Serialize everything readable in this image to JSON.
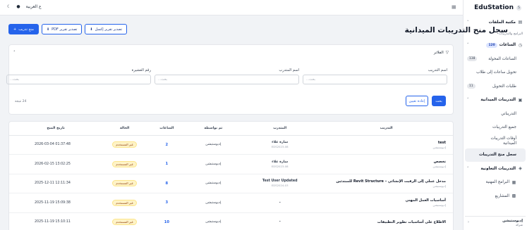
{
  "brand": {
    "title": "EduStation",
    "badge": "S"
  },
  "topbar": {
    "language": "العربية",
    "language_prefix": "ع"
  },
  "sidebar": {
    "items": [
      {
        "label": "مكتبة الملفات",
        "kind": "section",
        "icon": "folder-icon",
        "chevron": "˅"
      },
      {
        "label": "البرامج والتدريبات",
        "kind": "small"
      },
      {
        "label": "الساعات",
        "kind": "section",
        "icon": "clock-icon",
        "badge": "120",
        "chevron": "˄"
      },
      {
        "label": "الساعات المحولة",
        "kind": "sub",
        "badge": "138",
        "badge_left": true
      },
      {
        "label": "تحويل ساعات إلى طلاب",
        "kind": "sub"
      },
      {
        "label": "طلبات التحويل",
        "kind": "sub",
        "badge": "11",
        "badge_left": true
      },
      {
        "label": "التدريبات الميدانية",
        "kind": "section",
        "icon": "briefcase-icon",
        "chevron": "˄"
      },
      {
        "label": "التدريباتي",
        "kind": "sub"
      },
      {
        "label": "جميع التدريبات",
        "kind": "sub"
      },
      {
        "label": "أوقات التدريبات الميدانية",
        "kind": "sub",
        "wrap": true
      },
      {
        "label": "سجل منح التدريبات",
        "kind": "sub",
        "active": true
      },
      {
        "label": "التدريبات التعاونية",
        "kind": "section",
        "icon": "handshake-icon",
        "chevron": "˄"
      },
      {
        "label": "البرامج المهنية",
        "kind": "sub",
        "icon": "book-icon"
      },
      {
        "label": "المشاريع",
        "kind": "sub",
        "icon": "grid-icon"
      }
    ],
    "user": {
      "name": "إديوستيشن",
      "org": "شركة"
    }
  },
  "main": {
    "title": "سجل منح التدريبات الميدانية",
    "actions": [
      {
        "label": "منح تدريب",
        "icon": "+",
        "primary": true
      },
      {
        "label": "تصدير تقرير PDF",
        "icon": "⬇",
        "primary": false
      },
      {
        "label": "تصدير تقرير إكسل",
        "icon": "⬇",
        "primary": false
      }
    ]
  },
  "filters": {
    "title": "الفلاتر",
    "fields": [
      {
        "label": "اسم التدريب",
        "placeholder": "بحث..."
      },
      {
        "label": "اسم المتدرب",
        "placeholder": "بحث..."
      },
      {
        "label": "رقم العشيرة",
        "placeholder": "بحث..."
      }
    ],
    "search_label": "بحث",
    "reset_label": "إعادة تعيين",
    "count_label": "24 نتيجة"
  },
  "table": {
    "headers": [
      "التدريب",
      "المتدرب",
      "تم بواسطة",
      "الساعات",
      "الحالة",
      "تاريخ المنح"
    ],
    "rows": [
      {
        "training": "test",
        "training_sub": "إديوستيشن",
        "trainee": "سارة علاء",
        "trainee_sub": "EDS2023-08",
        "by": "إديوستيشن",
        "hours": "2",
        "status": "غير المستخدم",
        "date": "2026-03-04 01:37:48"
      },
      {
        "training": "تخصص",
        "training_sub": "إديوستيشن",
        "trainee": "سارة علاء",
        "trainee_sub": "EDS2023-08",
        "by": "إديوستيشن",
        "hours": "1",
        "status": "غير المستخدم",
        "date": "2026-02-15 13:02:25"
      },
      {
        "training": "مدخل عملي إلى الرفيت الإنشائي – Revit Structure للمبتدئين",
        "training_sub": "إديوستيشن",
        "trainee": "Test User Updated",
        "trainee_sub": "EDS2024-03",
        "by": "إديوستيشن",
        "hours": "8",
        "status": "غير المستخدم",
        "date": "2025-12-11 12:11:34"
      },
      {
        "training": "أساسيات العمل المهني",
        "training_sub": "إديوستيشن",
        "trainee": "-",
        "trainee_sub": "",
        "by": "إديوستيشن",
        "hours": "3",
        "status": "غير المستخدم",
        "date": "2025-11-19 15:09:38"
      },
      {
        "training": "الاطلاع على أساسيات تطوير التطبيقات",
        "training_sub": "",
        "trainee": "-",
        "trainee_sub": "",
        "by": "إديوستيشن",
        "hours": "10",
        "status": "غير المستخدم",
        "date": "2025-11-19 15:10:11"
      }
    ]
  }
}
